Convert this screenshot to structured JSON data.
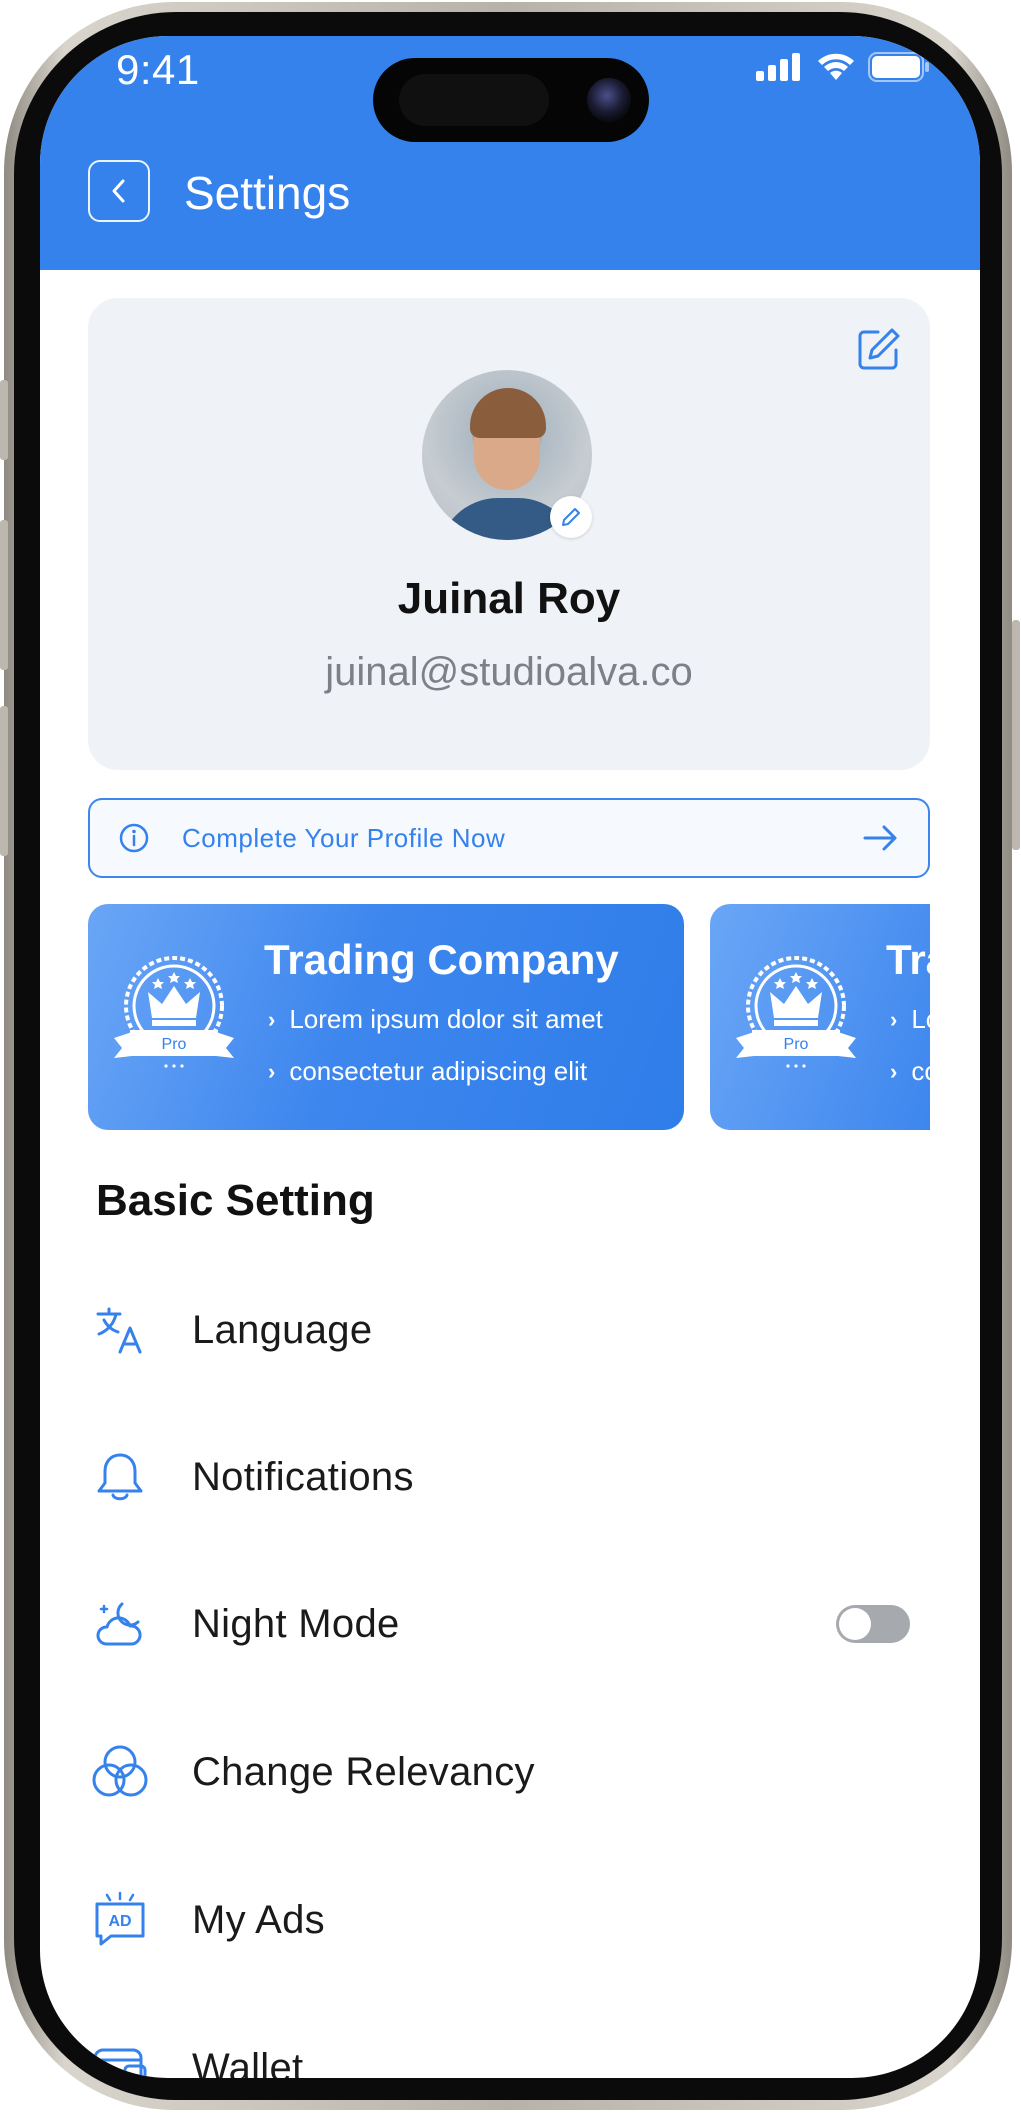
{
  "status_bar": {
    "time": "9:41"
  },
  "header": {
    "title": "Settings",
    "back_icon": "chevron-left-icon",
    "color": "#3582ec"
  },
  "profile": {
    "name": "Juinal Roy",
    "email": "juinal@studioalva.co",
    "edit_icon": "edit-square-icon",
    "avatar_edit_icon": "pencil-icon"
  },
  "complete_profile": {
    "label": "Complete Your Profile Now",
    "icon": "info-icon",
    "arrow_icon": "arrow-right-icon"
  },
  "plans": [
    {
      "title": "Trading Company",
      "badge": "Pro",
      "features": [
        "Lorem ipsum dolor sit amet",
        "consectetur adipiscing elit"
      ]
    },
    {
      "title": "Trading Company",
      "badge": "Pro",
      "features": [
        "Lorem ipsum dolor sit amet",
        "consectetur adipiscing elit"
      ]
    }
  ],
  "basic_setting": {
    "title": "Basic Setting",
    "items": [
      {
        "label": "Language",
        "icon": "translate-icon"
      },
      {
        "label": "Notifications",
        "icon": "bell-icon"
      },
      {
        "label": "Night Mode",
        "icon": "weather-night-icon",
        "toggle": false
      },
      {
        "label": "Change Relevancy",
        "icon": "circles-icon"
      },
      {
        "label": "My Ads",
        "icon": "ads-icon"
      },
      {
        "label": "Wallet",
        "icon": "wallet-icon"
      }
    ]
  },
  "colors": {
    "accent": "#3582ec",
    "card_bg": "#eff2f7",
    "text": "#111111",
    "muted": "#7d8087"
  }
}
